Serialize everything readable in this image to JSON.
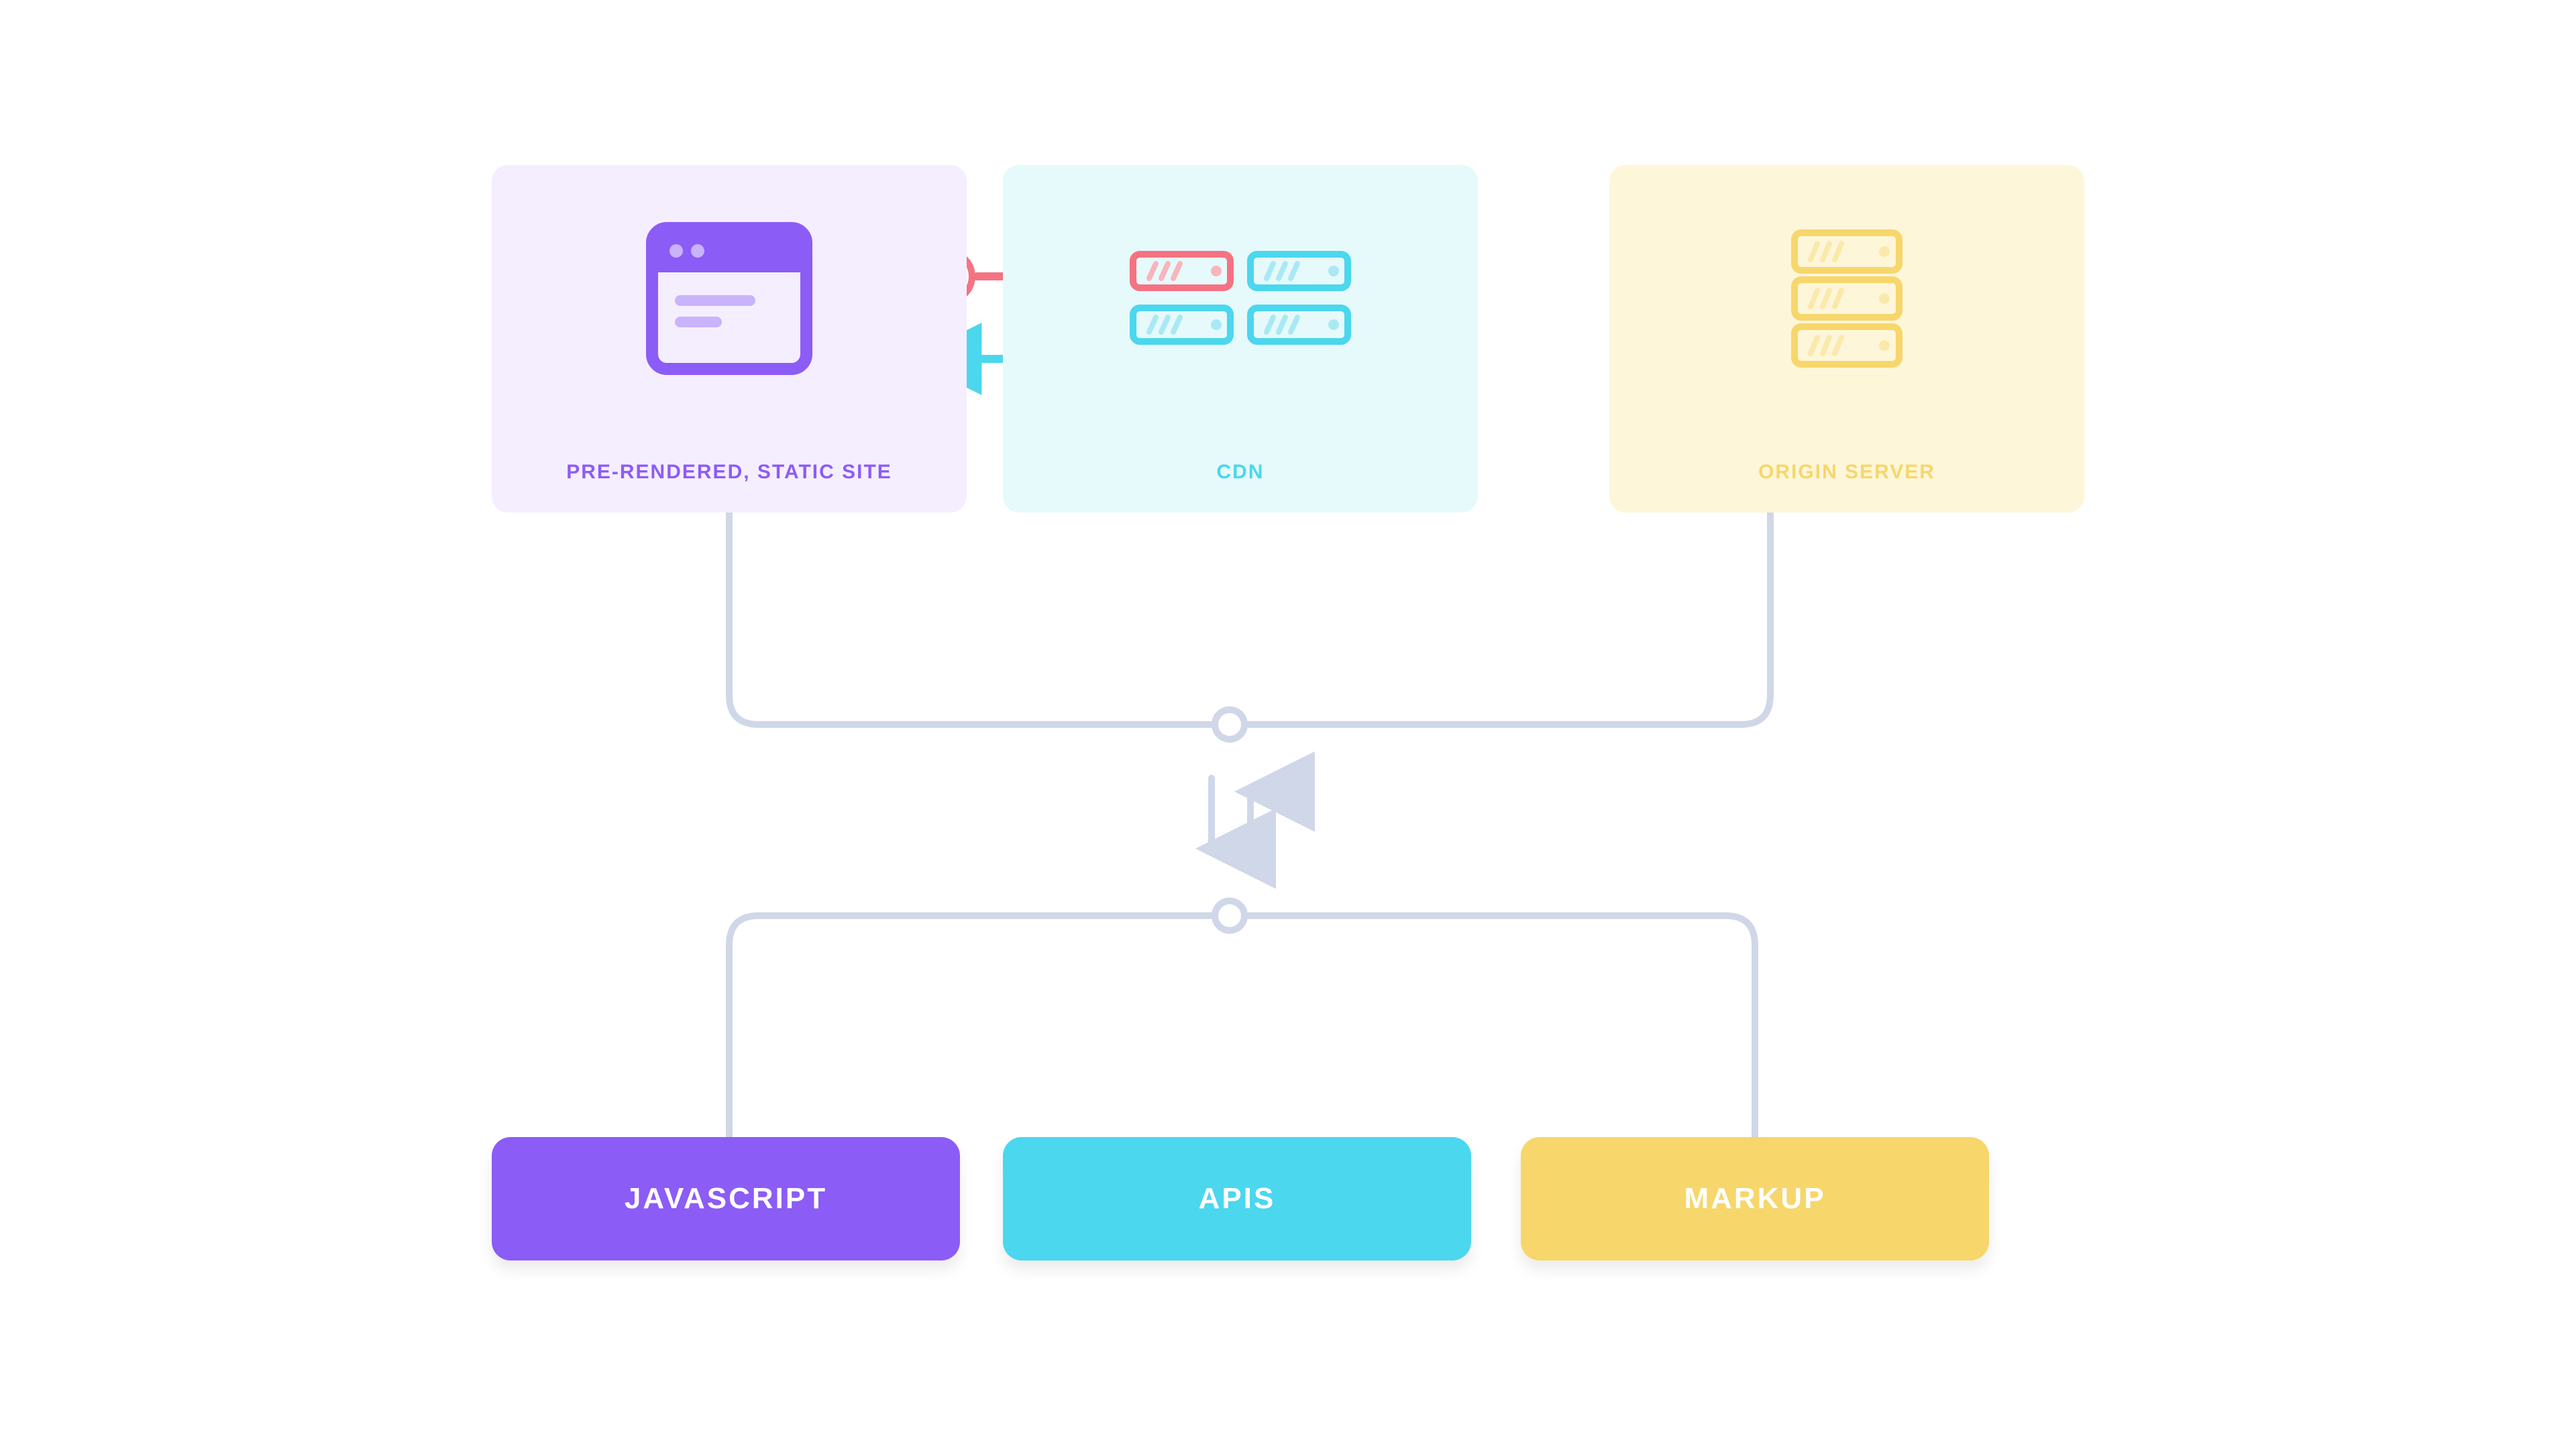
{
  "diagram": {
    "top_nodes": {
      "static_site": {
        "label": "PRE-RENDERED, STATIC SITE"
      },
      "cdn": {
        "label": "CDN"
      },
      "origin": {
        "label": "ORIGIN SERVER"
      }
    },
    "bottom_nodes": {
      "javascript": {
        "label": "JAVASCRIPT"
      },
      "apis": {
        "label": "APIs"
      },
      "markup": {
        "label": "MARKUP"
      }
    }
  },
  "colors": {
    "purple": "#8C5CF6",
    "cyan": "#4BD7EE",
    "yellow": "#F7D66B",
    "red": "#F47382",
    "connector": "#CFD7E8"
  }
}
